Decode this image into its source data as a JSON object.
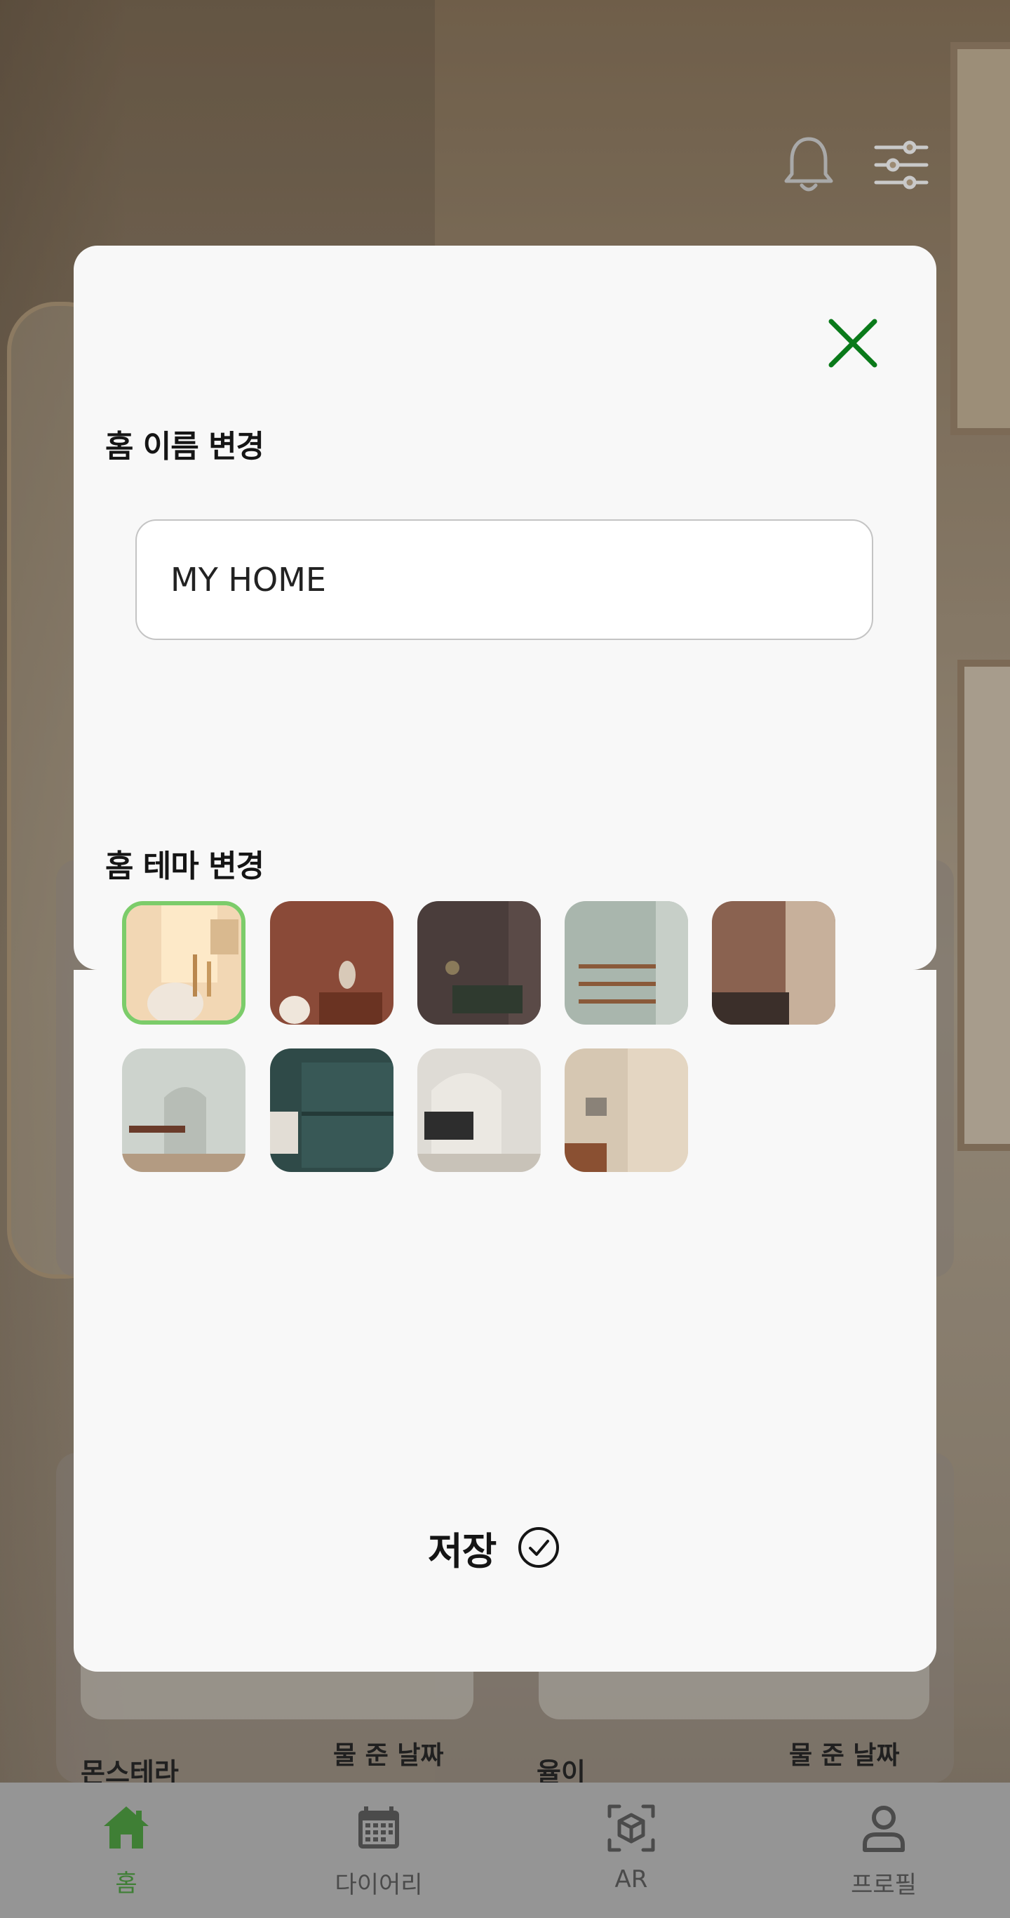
{
  "modal": {
    "name_section_title": "홈 이름 변경",
    "name_input_value": "MY HOME",
    "theme_section_title": "홈 테마 변경",
    "selected_theme_index": 0,
    "save_label": "저장"
  },
  "themes": [
    {
      "name": "theme-1"
    },
    {
      "name": "theme-2"
    },
    {
      "name": "theme-3"
    },
    {
      "name": "theme-4"
    },
    {
      "name": "theme-5"
    },
    {
      "name": "theme-6"
    },
    {
      "name": "theme-7"
    },
    {
      "name": "theme-8"
    },
    {
      "name": "theme-9"
    }
  ],
  "background_list": {
    "plants": [
      {
        "name": "몬스테라",
        "date_label": "물 준 날짜"
      },
      {
        "name": "율이",
        "date_label": "물 준 날짜"
      }
    ]
  },
  "nav": {
    "items": [
      {
        "label": "홈",
        "icon": "home-icon",
        "active": true
      },
      {
        "label": "다이어리",
        "icon": "calendar-icon",
        "active": false
      },
      {
        "label": "AR",
        "icon": "ar-cube-icon",
        "active": false
      },
      {
        "label": "프로필",
        "icon": "profile-icon",
        "active": false
      }
    ]
  },
  "colors": {
    "accent_green": "#0a7a1a",
    "selected_border": "#7ccc6a",
    "nav_active": "#3f7f35"
  }
}
